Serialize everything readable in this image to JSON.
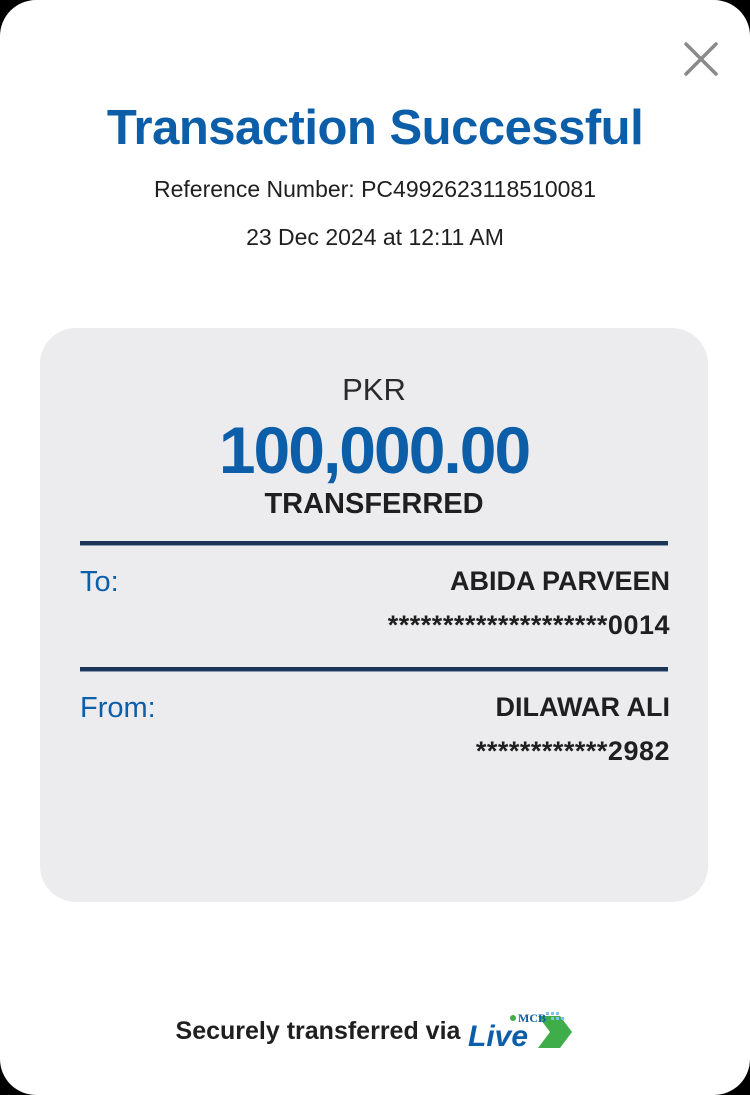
{
  "header": {
    "title": "Transaction Successful",
    "reference": "Reference Number: PC4992623118510081",
    "datetime": "23 Dec 2024 at 12:11 AM",
    "close_icon": "close-icon"
  },
  "transfer": {
    "currency": "PKR",
    "amount": "100,000.00",
    "status": "TRANSFERRED"
  },
  "to": {
    "label": "To:",
    "name": "ABIDA PARVEEN",
    "account": "********************0014"
  },
  "from": {
    "label": "From:",
    "name": "DILAWAR ALI",
    "account": "************2982"
  },
  "footer": {
    "text": "Securely transferred via",
    "logo_top": "MCB",
    "logo_main": "Live"
  },
  "colors": {
    "brand_blue": "#0c5ea8",
    "logo_green": "#3fae4a",
    "panel_bg": "#ececee"
  }
}
